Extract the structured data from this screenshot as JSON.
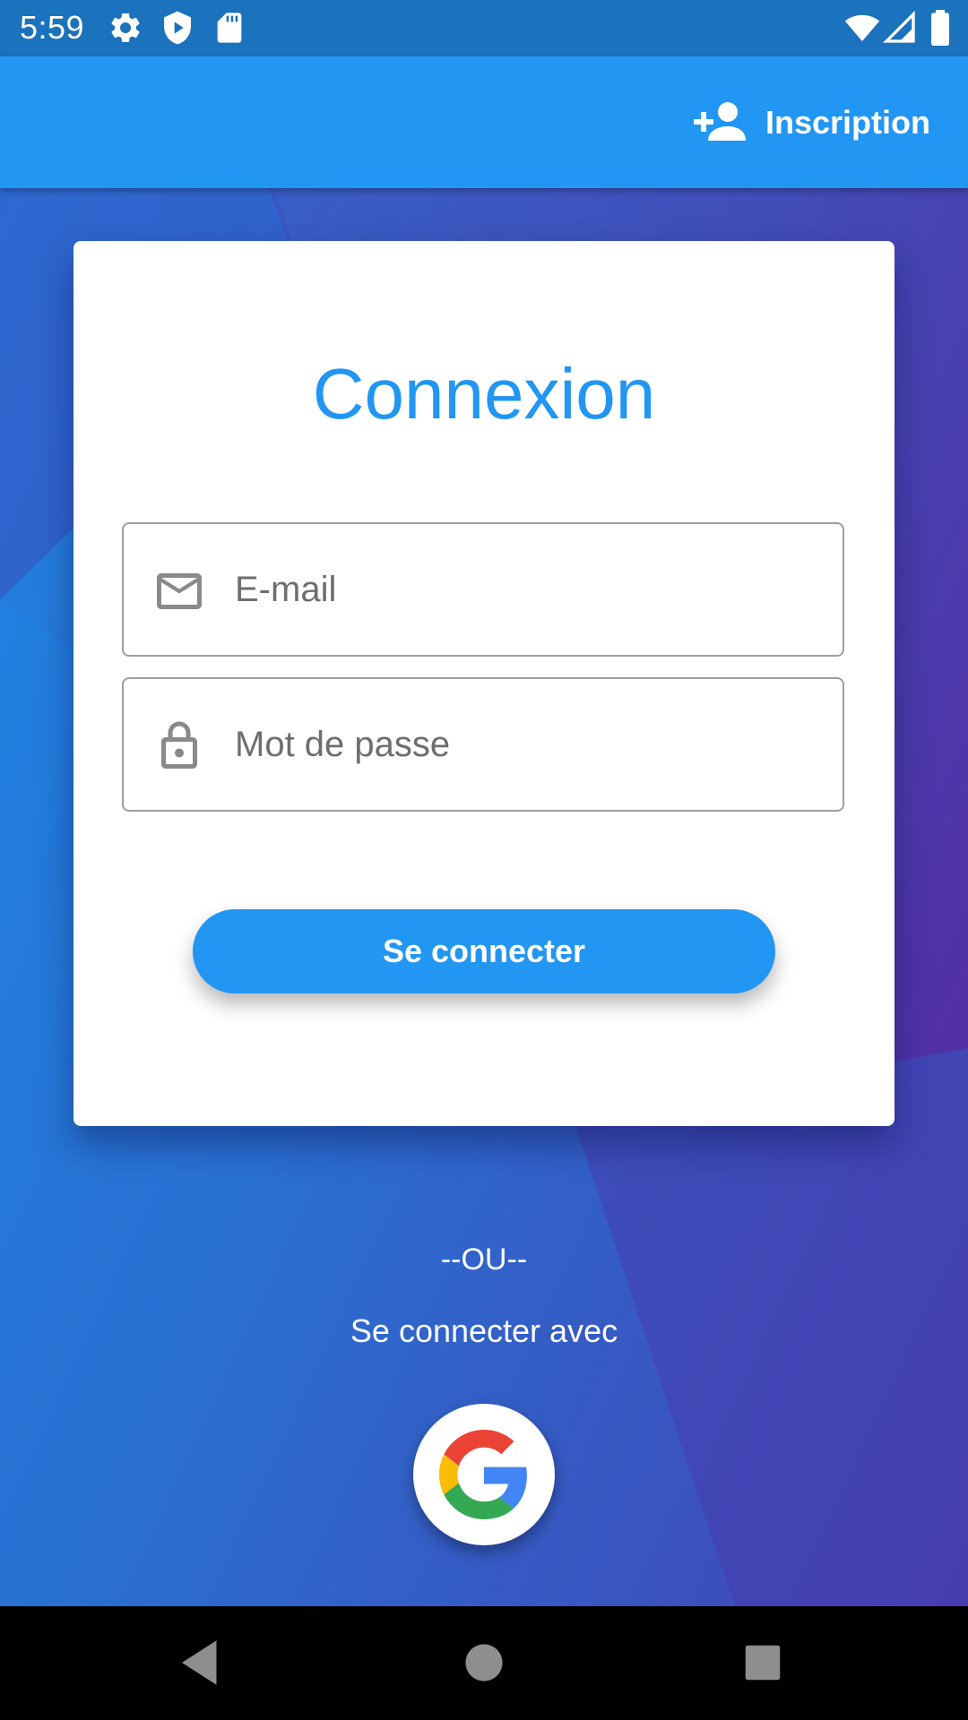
{
  "status_bar": {
    "time": "5:59",
    "left_icons": [
      "settings-icon",
      "shield-play-icon",
      "sd-card-icon"
    ],
    "right_icons": [
      "wifi-icon",
      "cell-signal-icon",
      "battery-icon"
    ]
  },
  "app_bar": {
    "action_label": "Inscription",
    "action_icon": "person-add-icon",
    "color": "#2196f3"
  },
  "login_card": {
    "title": "Connexion",
    "email": {
      "placeholder": "E-mail",
      "value": "",
      "icon": "mail-icon"
    },
    "password": {
      "placeholder": "Mot de passe",
      "value": "",
      "icon": "lock-icon"
    },
    "submit_label": "Se connecter"
  },
  "alternative": {
    "separator": "--OU--",
    "prompt": "Se connecter avec",
    "provider_icon": "google-icon"
  },
  "nav_bar": {
    "buttons": [
      "back-icon",
      "home-icon",
      "recents-icon"
    ]
  },
  "colors": {
    "accent": "#2196f3",
    "status_bar": "#1b72bd",
    "background_start": "#1e88e5",
    "background_end": "#5a1f9a"
  }
}
